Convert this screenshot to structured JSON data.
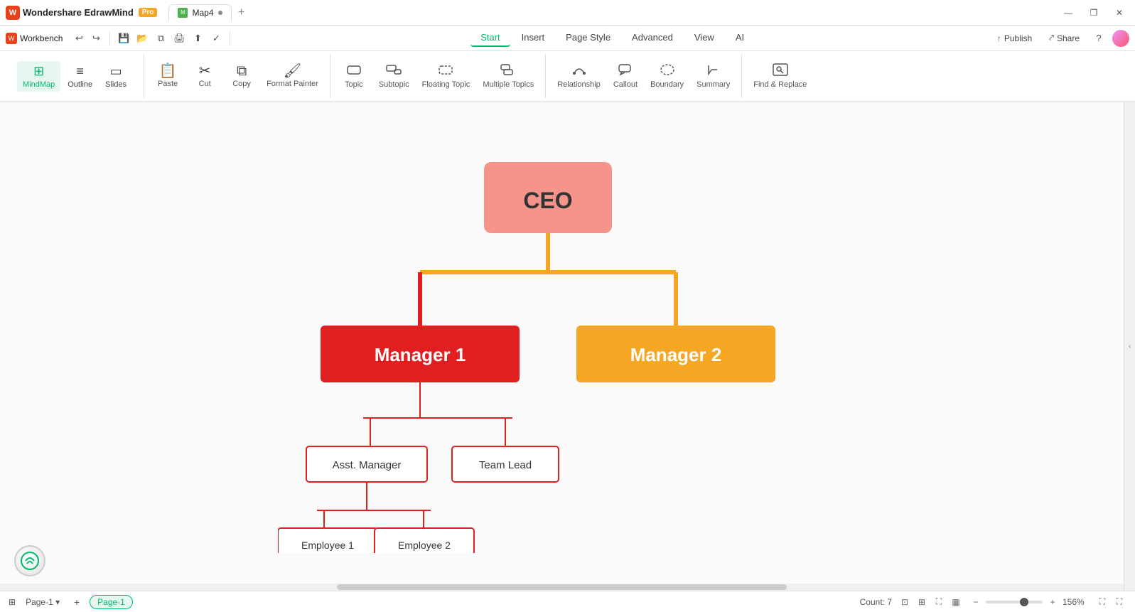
{
  "app": {
    "name": "Wondershare EdrawMind",
    "pro_badge": "Pro",
    "logo_letter": "W"
  },
  "titlebar": {
    "tabs": [
      {
        "id": "tab-map4",
        "label": "Map4",
        "icon_letter": "M",
        "active": true,
        "modified": true
      },
      {
        "id": "tab-new",
        "label": "+",
        "icon_letter": ""
      }
    ],
    "window_controls": {
      "minimize": "—",
      "maximize": "❐",
      "close": "✕"
    }
  },
  "menubar": {
    "workbench_label": "Workbench",
    "history_undo": "↩",
    "history_redo": "↪",
    "menus": [
      {
        "id": "menu-start",
        "label": "Start",
        "active": true
      },
      {
        "id": "menu-insert",
        "label": "Insert",
        "active": false
      },
      {
        "id": "menu-page-style",
        "label": "Page Style",
        "active": false
      },
      {
        "id": "menu-advanced",
        "label": "Advanced",
        "active": false
      },
      {
        "id": "menu-view",
        "label": "View",
        "active": false
      },
      {
        "id": "menu-ai",
        "label": "AI",
        "active": false
      }
    ],
    "publish_label": "Publish",
    "share_label": "Share"
  },
  "toolbar": {
    "view_buttons": [
      {
        "id": "view-mindmap",
        "label": "MindMap",
        "icon": "⊞",
        "active": true
      },
      {
        "id": "view-outline",
        "label": "Outline",
        "icon": "≡",
        "active": false
      },
      {
        "id": "view-slides",
        "label": "Slides",
        "icon": "▭",
        "active": false
      }
    ],
    "buttons": [
      {
        "id": "btn-paste",
        "label": "Paste",
        "icon": "📋",
        "disabled": false
      },
      {
        "id": "btn-cut",
        "label": "Cut",
        "icon": "✂",
        "disabled": false
      },
      {
        "id": "btn-copy",
        "label": "Copy",
        "icon": "⧉",
        "disabled": false
      },
      {
        "id": "btn-format-painter",
        "label": "Format Painter",
        "icon": "🖌",
        "disabled": false
      },
      {
        "id": "btn-topic",
        "label": "Topic",
        "icon": "⬜",
        "disabled": false
      },
      {
        "id": "btn-subtopic",
        "label": "Subtopic",
        "icon": "⬛",
        "disabled": false
      },
      {
        "id": "btn-floating-topic",
        "label": "Floating Topic",
        "icon": "◫",
        "disabled": false
      },
      {
        "id": "btn-multiple-topics",
        "label": "Multiple Topics",
        "icon": "⊟",
        "disabled": false
      },
      {
        "id": "btn-relationship",
        "label": "Relationship",
        "icon": "↗",
        "disabled": false
      },
      {
        "id": "btn-callout",
        "label": "Callout",
        "icon": "💬",
        "disabled": false
      },
      {
        "id": "btn-boundary",
        "label": "Boundary",
        "icon": "⬡",
        "disabled": false
      },
      {
        "id": "btn-summary",
        "label": "Summary",
        "icon": "≣",
        "disabled": false
      },
      {
        "id": "btn-find-replace",
        "label": "Find & Replace",
        "icon": "🔍",
        "disabled": false
      }
    ]
  },
  "chart": {
    "ceo_label": "CEO",
    "manager1_label": "Manager 1",
    "manager2_label": "Manager 2",
    "asst_manager_label": "Asst. Manager",
    "team_lead_label": "Team Lead",
    "employee1_label": "Employee 1",
    "employee2_label": "Employee 2"
  },
  "bottombar": {
    "page_label": "Page-1",
    "page_tab": "Page-1",
    "add_page": "+",
    "count_label": "Count: 7",
    "zoom_percent": "156%",
    "zoom_minus": "−",
    "zoom_plus": "+"
  }
}
